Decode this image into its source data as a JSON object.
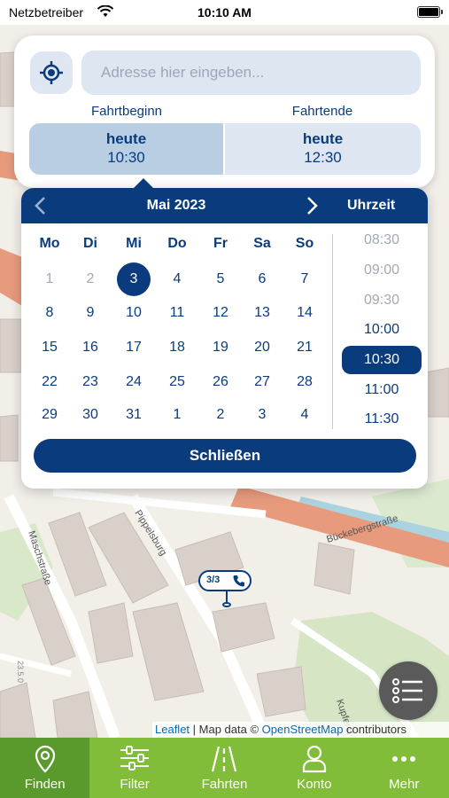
{
  "status_bar": {
    "carrier": "Netzbetreiber",
    "time": "10:10 AM"
  },
  "search": {
    "placeholder": "Adresse hier eingeben...",
    "begin_label": "Fahrtbeginn",
    "end_label": "Fahrtende",
    "begin": {
      "day": "heute",
      "time": "10:30"
    },
    "end": {
      "day": "heute",
      "time": "12:30"
    }
  },
  "calendar": {
    "month": "Mai 2023",
    "time_header": "Uhrzeit",
    "weekdays": [
      "Mo",
      "Di",
      "Mi",
      "Do",
      "Fr",
      "Sa",
      "So"
    ],
    "weeks": [
      [
        "1",
        "2",
        "3",
        "4",
        "5",
        "6",
        "7"
      ],
      [
        "8",
        "9",
        "10",
        "11",
        "12",
        "13",
        "14"
      ],
      [
        "15",
        "16",
        "17",
        "18",
        "19",
        "20",
        "21"
      ],
      [
        "22",
        "23",
        "24",
        "25",
        "26",
        "27",
        "28"
      ],
      [
        "29",
        "30",
        "31",
        "1",
        "2",
        "3",
        "4"
      ]
    ],
    "selected_day": "3",
    "times": [
      "08:30",
      "09:00",
      "09:30",
      "10:00",
      "10:30",
      "11:00",
      "11:30"
    ],
    "selected_time": "10:30",
    "close_label": "Schließen"
  },
  "map": {
    "streets": [
      "Maschstraße",
      "Pippelsburg",
      "Bückebergstraße",
      "Kupferst",
      "23.5.0"
    ],
    "marker_label": "3/3",
    "attribution": {
      "leaflet": "Leaflet",
      "sep": " | Map data © ",
      "osm": "OpenStreetMap",
      "suffix": " contributors"
    }
  },
  "nav": [
    {
      "label": "Finden",
      "icon": "location-pin-icon",
      "active": true
    },
    {
      "label": "Filter",
      "icon": "sliders-icon",
      "active": false
    },
    {
      "label": "Fahrten",
      "icon": "road-icon",
      "active": false
    },
    {
      "label": "Konto",
      "icon": "person-icon",
      "active": false
    },
    {
      "label": "Mehr",
      "icon": "more-dots-icon",
      "active": false
    }
  ],
  "colors": {
    "primary": "#0a3c7d",
    "nav_green": "#82bd3a",
    "nav_active": "#5a9a2c",
    "field_bg": "#dde6f1"
  }
}
